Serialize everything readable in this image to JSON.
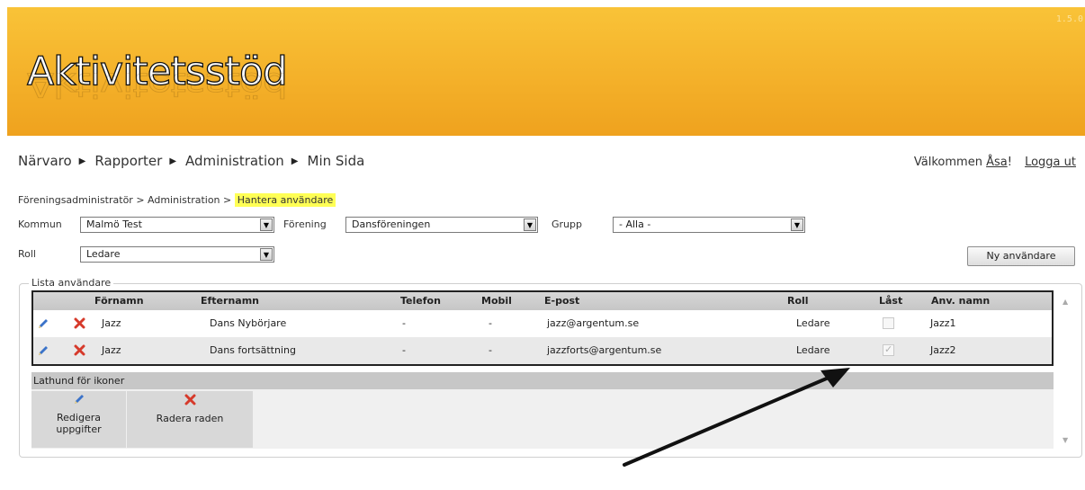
{
  "app": {
    "version": "1.5.0",
    "logo_text": "Aktivitetsstöd"
  },
  "nav": {
    "items": [
      {
        "label": "Närvaro"
      },
      {
        "label": "Rapporter"
      },
      {
        "label": "Administration"
      },
      {
        "label": "Min Sida"
      }
    ],
    "separator_icon": "triangle-right-icon"
  },
  "user": {
    "welcome_prefix": "Välkommen",
    "name": "Åsa",
    "suffix": "!",
    "logout_label": "Logga ut"
  },
  "breadcrumb": {
    "parts": "Föreningsadministratör > Administration >",
    "current": "Hantera användare"
  },
  "filters": {
    "kommun": {
      "label": "Kommun",
      "value": "Malmö Test"
    },
    "forening": {
      "label": "Förening",
      "value": "Dansföreningen"
    },
    "grupp": {
      "label": "Grupp",
      "value": "- Alla -"
    },
    "roll": {
      "label": "Roll",
      "value": "Ledare"
    }
  },
  "new_user_button": "Ny användare",
  "user_list": {
    "legend": "Lista användare",
    "columns": [
      "Förnamn",
      "Efternamn",
      "Telefon",
      "Mobil",
      "E-post",
      "Roll",
      "Låst",
      "Anv. namn"
    ],
    "rows": [
      {
        "fornamn": "Jazz",
        "efternamn": "Dans Nybörjare",
        "telefon": "-",
        "mobil": "-",
        "epost": "jazz@argentum.se",
        "roll": "Ledare",
        "locked": false,
        "anvnamn": "Jazz1"
      },
      {
        "fornamn": "Jazz",
        "efternamn": "Dans fortsättning",
        "telefon": "-",
        "mobil": "-",
        "epost": "jazzforts@argentum.se",
        "roll": "Ledare",
        "locked": true,
        "anvnamn": "Jazz2"
      }
    ]
  },
  "icon_legend": {
    "title": "Lathund för ikoner",
    "items": [
      {
        "icon": "pencil-icon",
        "label": "Redigera uppgifter"
      },
      {
        "icon": "red-x-icon",
        "label": "Radera raden"
      }
    ]
  },
  "colors": {
    "header": "#f4b12a",
    "highlight": "#ffff55",
    "delete": "#d63a2b",
    "edit": "#3b73c9"
  }
}
